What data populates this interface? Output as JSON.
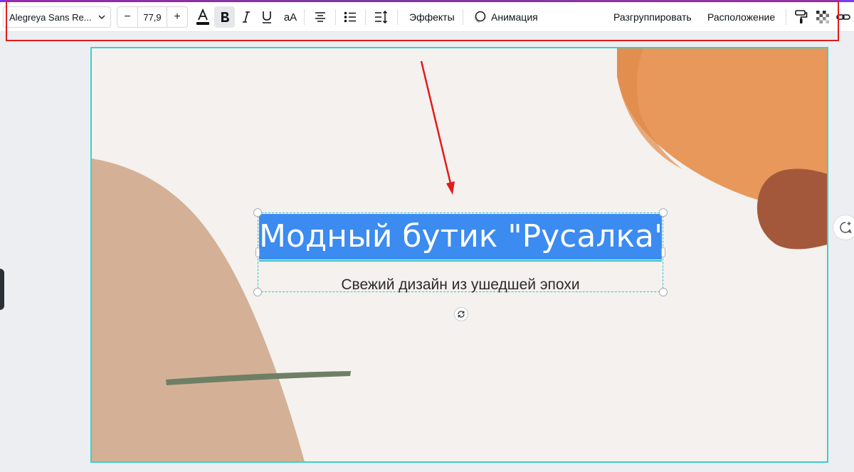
{
  "toolbar": {
    "font_name": "Alegreya Sans Re...",
    "font_size": "77,9",
    "decrease_label": "−",
    "increase_label": "+",
    "case_label": "aA",
    "effects_label": "Эффекты",
    "animation_label": "Анимация",
    "ungroup_label": "Разгруппировать",
    "position_label": "Расположение"
  },
  "canvas": {
    "title": "Модный бутик \"Русалка\"",
    "subtitle": "Свежий дизайн из ушедшей эпохи"
  },
  "colors": {
    "accent_selection": "#3b8bf0",
    "frame": "#3ccfcf",
    "annotation": "#e21b1b",
    "shape_tan": "#d4b196",
    "shape_orange": "#e7985a",
    "shape_brown": "#a4583b",
    "shape_green": "#6e7f66"
  },
  "icons": {
    "font_dropdown": "chevron-down-icon",
    "text_color": "text-color-icon",
    "bold": "bold-icon",
    "italic": "italic-icon",
    "underline": "underline-icon",
    "align": "align-center-icon",
    "list": "bullet-list-icon",
    "spacing": "line-spacing-icon",
    "animation": "animation-icon",
    "copy_style": "paint-roller-icon",
    "transparency": "transparency-icon",
    "link": "link-icon",
    "rotate": "rotate-icon",
    "comment": "add-comment-icon"
  }
}
